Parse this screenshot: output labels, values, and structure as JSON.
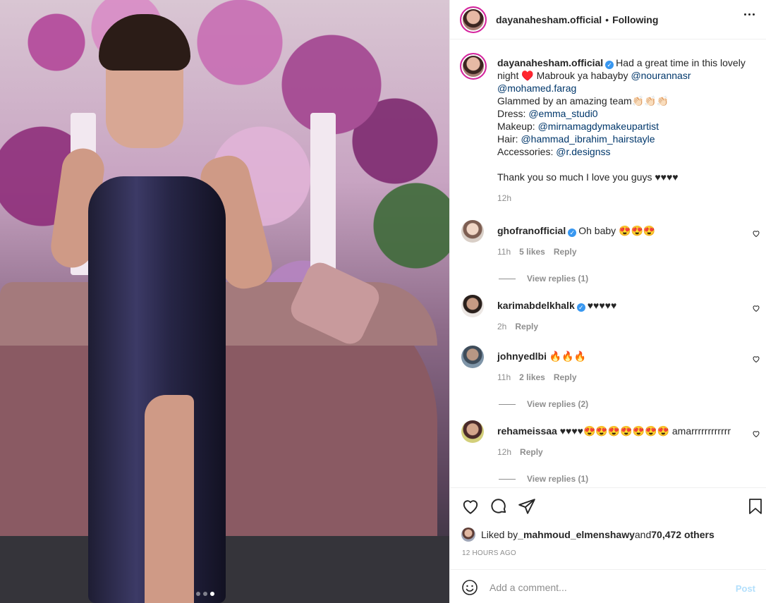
{
  "post": {
    "username": "dayanahesham.official",
    "separator": "•",
    "follow_status": "Following"
  },
  "caption": {
    "username": "dayanahesham.official",
    "text_1": "Had a great time in this lovely night ♥️ Mabrouk ya habayby ",
    "mention_1": "@nourannasr",
    "mention_2": "@mohamed.farag",
    "line_glam": "Glammed by an amazing team👏🏻👏🏻👏🏻",
    "dress_label": "Dress: ",
    "dress_mention": "@emma_studi0",
    "makeup_label": "Makeup: ",
    "makeup_mention": "@mirnamagdymakeupartist",
    "hair_label": "Hair: ",
    "hair_mention": "@hammad_ibrahim_hairstayle",
    "acc_label": "Accessories: ",
    "acc_mention": "@r.designss",
    "thanks": "Thank you so much I love you guys ♥♥♥♥",
    "time": "12h"
  },
  "comments": [
    {
      "username": "ghofranofficial",
      "text": "Oh baby 😍😍😍",
      "time": "11h",
      "likes": "5 likes",
      "reply": "Reply",
      "view_replies": "View replies (1)"
    },
    {
      "username": "karimabdelkhalk",
      "text": "♥♥♥♥♥",
      "time": "2h",
      "reply": "Reply"
    },
    {
      "username": "johnyedlbi",
      "text": "🔥🔥🔥",
      "time": "11h",
      "likes": "2 likes",
      "reply": "Reply",
      "view_replies": "View replies (2)"
    },
    {
      "username": "rehameissaa",
      "text": "♥♥♥♥😍😍😍😍😍😍😍 amarrrrrrrrrrrr",
      "time": "12h",
      "reply": "Reply",
      "view_replies": "View replies (1)"
    }
  ],
  "likes": {
    "prefix": "Liked by ",
    "user": "_mahmoud_elmenshawy",
    "middle": " and ",
    "count": "70,472 others"
  },
  "timestamp": "12 HOURS AGO",
  "add_comment": {
    "placeholder": "Add a comment...",
    "post_label": "Post"
  },
  "carousel": {
    "total": 3,
    "active_index": 2
  },
  "icons": [
    "more-icon",
    "verified-icon",
    "heart-icon",
    "comment-icon",
    "share-icon",
    "bookmark-icon",
    "emoji-icon"
  ],
  "colors": {
    "link": "#00376b",
    "verified": "#3897f0",
    "muted": "#8e8e8e",
    "post_button": "#b2dffc"
  }
}
